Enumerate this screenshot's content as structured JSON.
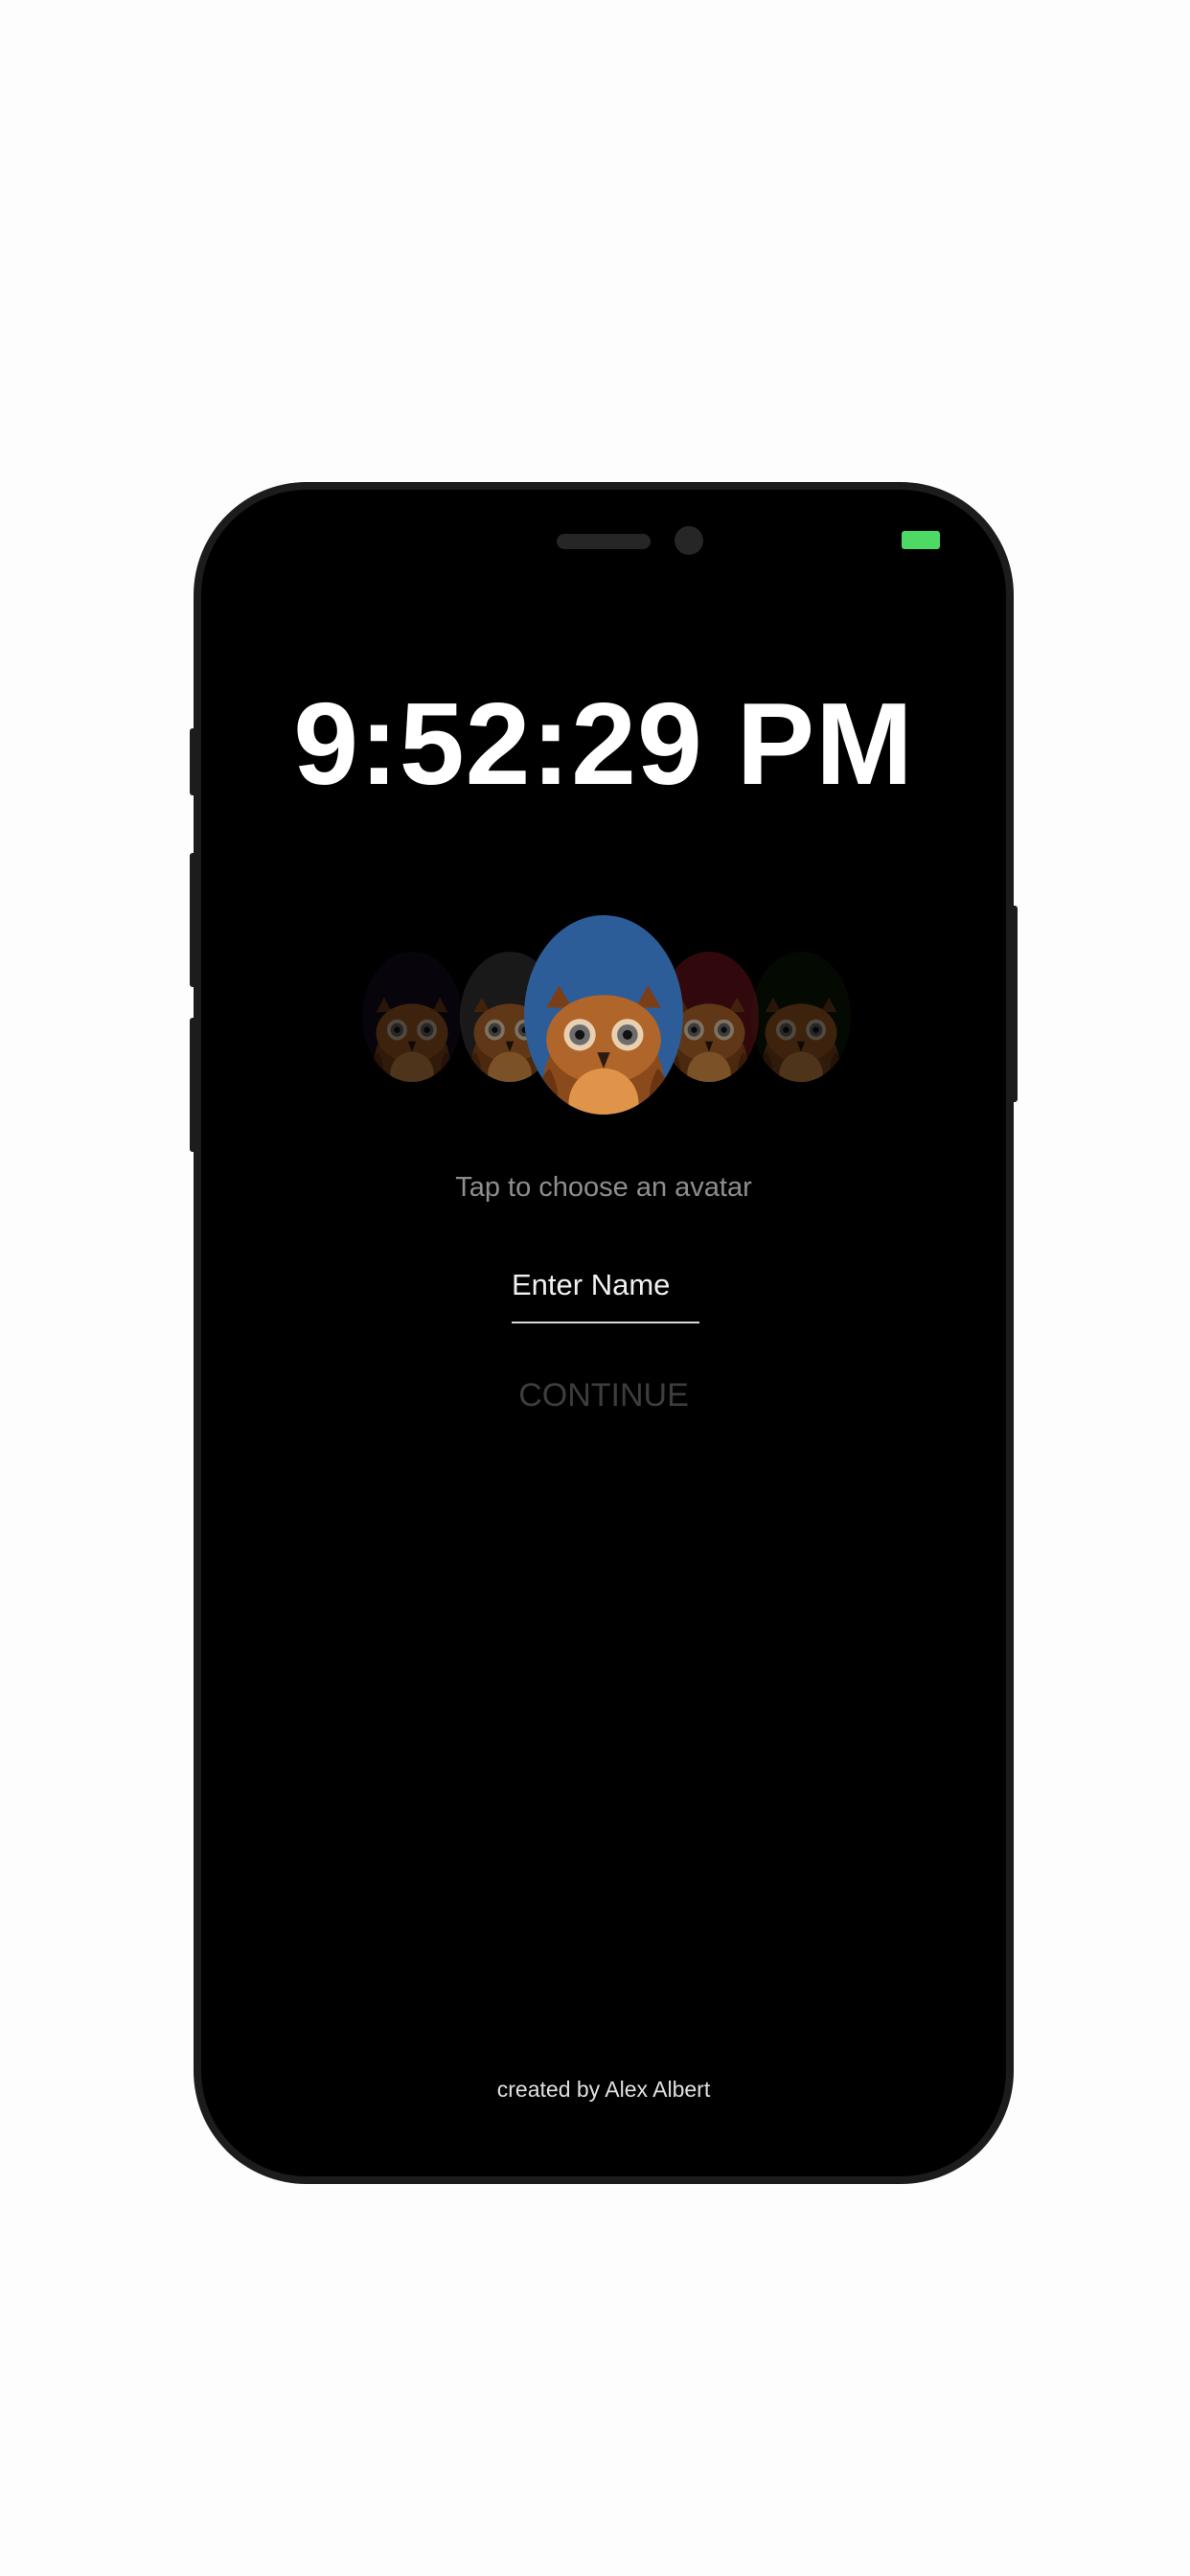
{
  "screen": {
    "time": "9:52:29 PM",
    "avatar_hint": "Tap to choose an avatar",
    "name_input": {
      "value": "",
      "placeholder": "Enter Name"
    },
    "continue_label": "CONTINUE",
    "credit": "created by Alex Albert"
  },
  "status_bar": {
    "battery_color": "#4cd964"
  },
  "avatars": [
    {
      "icon": "owl-avatar-icon",
      "color": "#140c24",
      "selected": false
    },
    {
      "icon": "owl-avatar-icon",
      "color": "#2e2e2e",
      "selected": false
    },
    {
      "icon": "owl-avatar-icon",
      "color": "#2d5d99",
      "selected": true
    },
    {
      "icon": "owl-avatar-icon",
      "color": "#5a1218",
      "selected": false
    },
    {
      "icon": "owl-avatar-icon",
      "color": "#0e1a06",
      "selected": false
    }
  ],
  "colors": {
    "background": "#000000",
    "text_primary": "#ffffff",
    "text_secondary": "#8e8e8e",
    "button_disabled": "#3d3d3d"
  }
}
